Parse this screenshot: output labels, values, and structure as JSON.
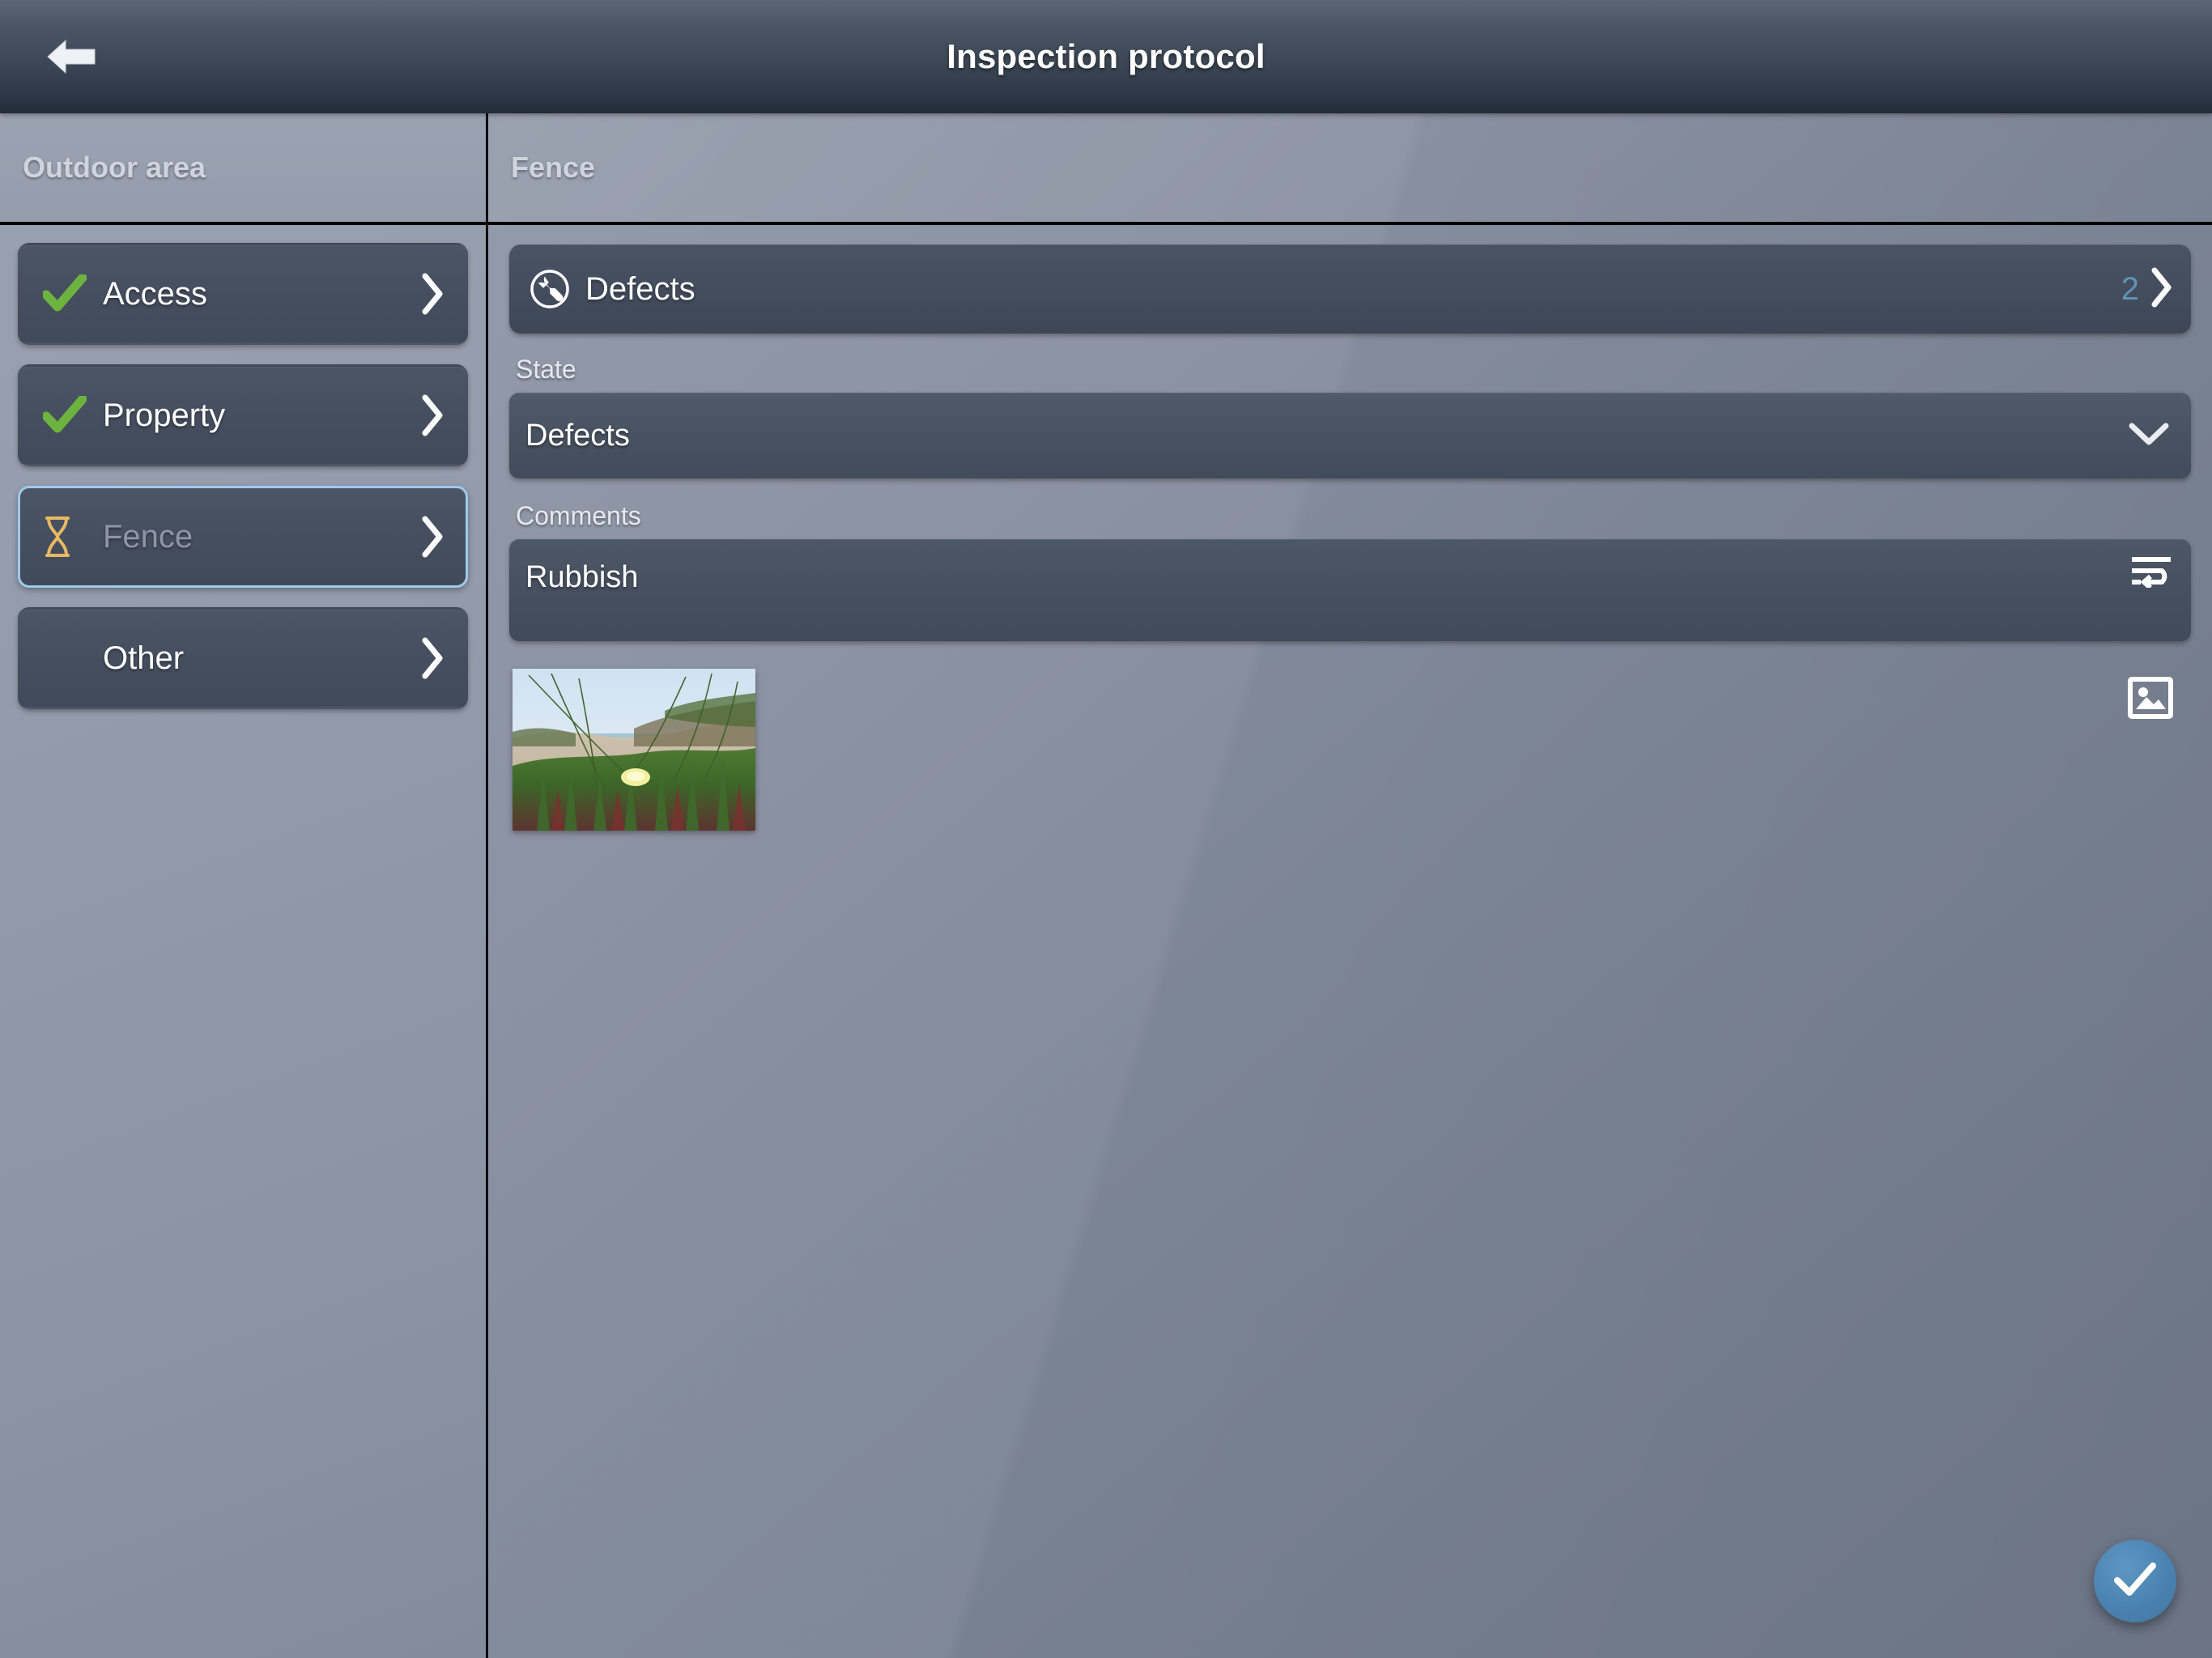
{
  "titlebar": {
    "back_icon": "back-arrow-icon",
    "title": "Inspection protocol"
  },
  "sidebar": {
    "header": "Outdoor area",
    "items": [
      {
        "label": "Access",
        "status": "done",
        "status_icon": "green-check-icon",
        "chevron": "chevron-right-icon",
        "selected": false
      },
      {
        "label": "Property",
        "status": "done",
        "status_icon": "green-check-icon",
        "chevron": "chevron-right-icon",
        "selected": false
      },
      {
        "label": "Fence",
        "status": "pending",
        "status_icon": "hourglass-icon",
        "chevron": "chevron-right-icon",
        "selected": true
      },
      {
        "label": "Other",
        "status": "none",
        "status_icon": "",
        "chevron": "chevron-right-icon",
        "selected": false
      }
    ]
  },
  "panel": {
    "header": "Fence",
    "defects_row": {
      "icon": "wrench-circle-icon",
      "label": "Defects",
      "count": "2",
      "chevron": "chevron-right-icon"
    },
    "state_field": {
      "label": "State",
      "value": "Defects",
      "chevron": "chevron-down-icon",
      "options": [
        "Defects"
      ]
    },
    "comments_field": {
      "label": "Comments",
      "value": "Rubbish",
      "placeholder": "",
      "wrap_icon": "text-wrap-icon"
    },
    "media": {
      "thumbnail_alt": "dune-vegetation-photo",
      "image_icon": "image-picker-icon"
    }
  },
  "fab": {
    "icon": "check-icon",
    "label": "Confirm",
    "color": "#4a82b0"
  },
  "colors": {
    "accent_blue": "#4a82b0",
    "count_blue": "#5e93b5",
    "check_green": "#6db33f",
    "hourglass_orange": "#e8b964",
    "selection_border": "#9ec9ef"
  }
}
